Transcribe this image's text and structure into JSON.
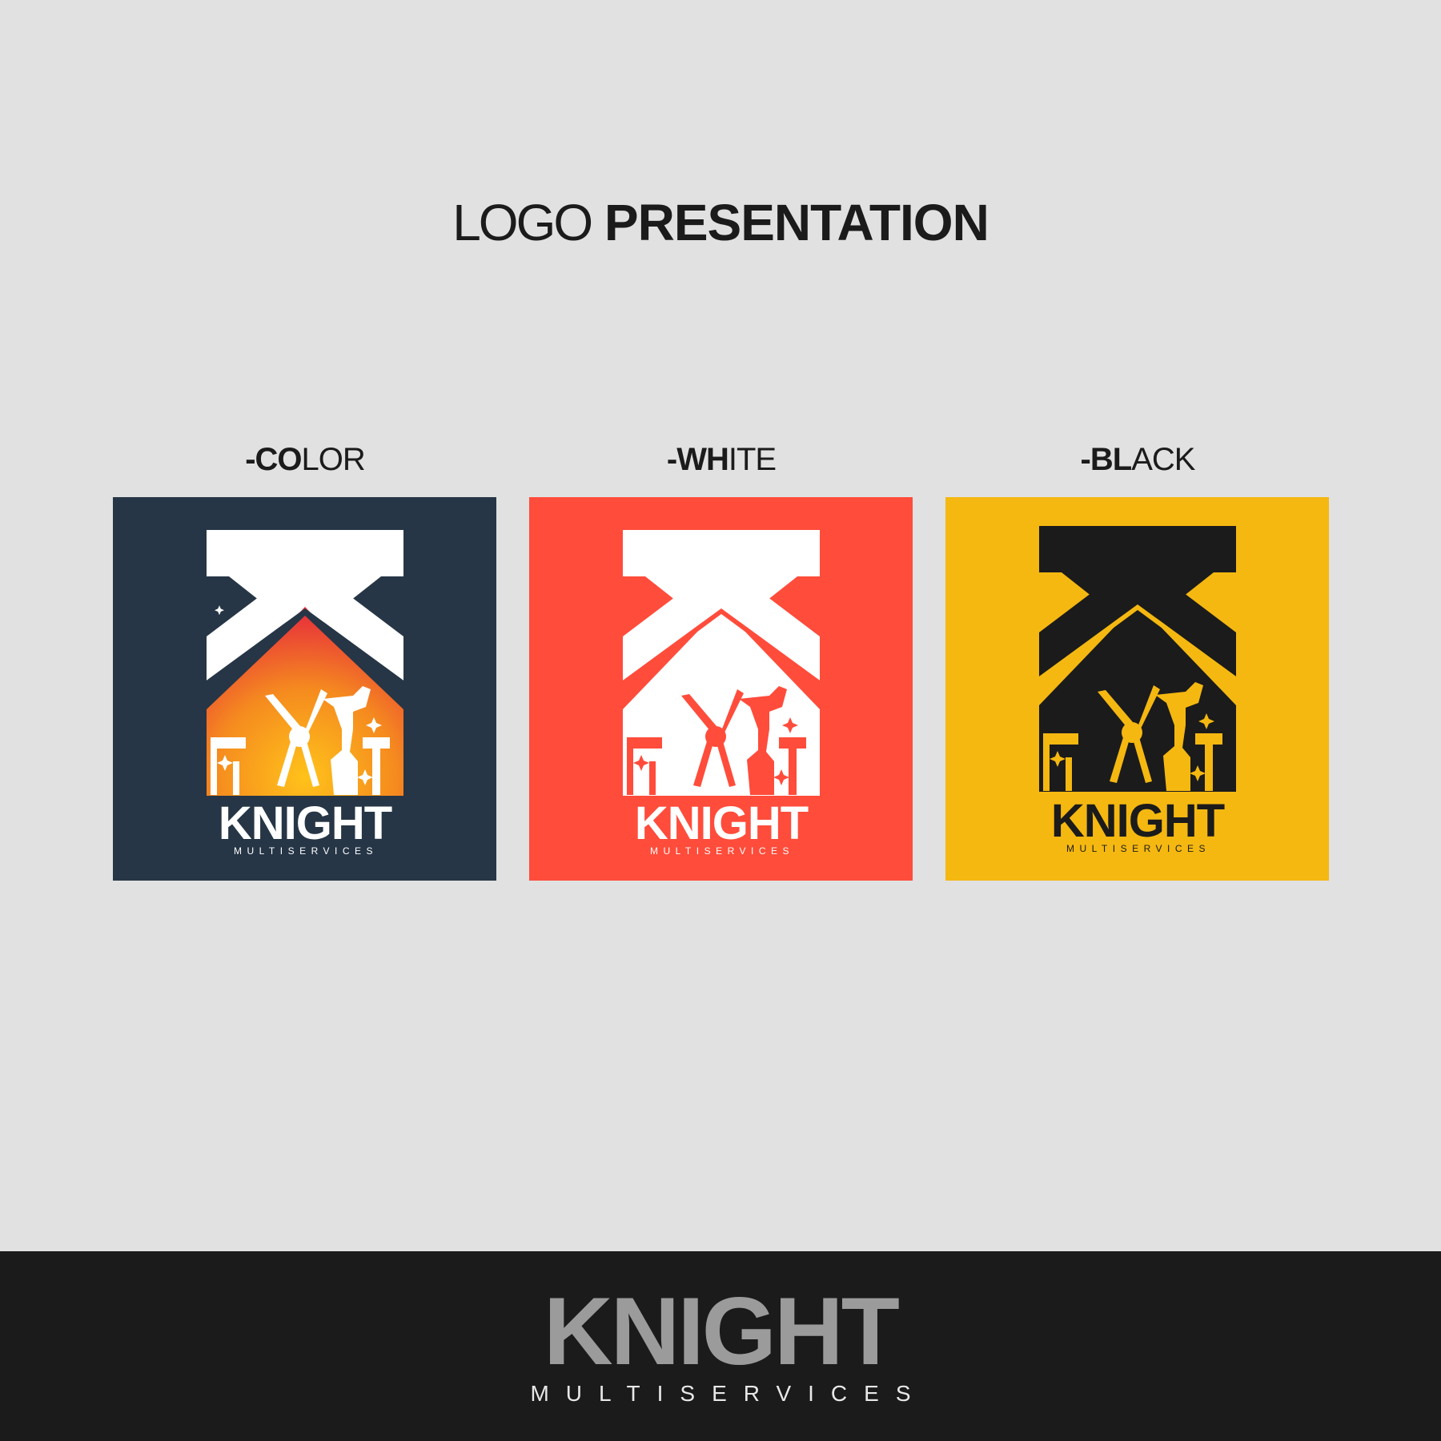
{
  "page_title": {
    "light": "LOGO",
    "bold": "PRESENTATION"
  },
  "variants": [
    {
      "label_bold": "-CO",
      "label_regular": "LOR",
      "background": "#263646",
      "mark_color": "#ffffff",
      "icon_fill": "orange-gradient",
      "wordmark": "KNIGHT",
      "subtitle": "MULTISERVICES"
    },
    {
      "label_bold": "-WH",
      "label_regular": "ITE",
      "background": "#ff4c3b",
      "mark_color": "#ffffff",
      "icon_fill": "#ff4c3b",
      "wordmark": "KNIGHT",
      "subtitle": "MULTISERVICES"
    },
    {
      "label_bold": "-BL",
      "label_regular": "ACK",
      "background": "#f5b811",
      "mark_color": "#1b1b1b",
      "icon_fill": "#f5b811",
      "wordmark": "KNIGHT",
      "subtitle": "MULTISERVICES"
    }
  ],
  "footer": {
    "brand": "KNIGHT",
    "tagline": "MULTISERVICES",
    "background": "#1b1b1b",
    "brand_color": "#9b9b9b"
  },
  "icons": [
    "k-roof-mark",
    "pruning-shears-icon",
    "spray-bottle-icon",
    "hammer-icon",
    "paint-roller-icon",
    "sparkle-icon"
  ]
}
